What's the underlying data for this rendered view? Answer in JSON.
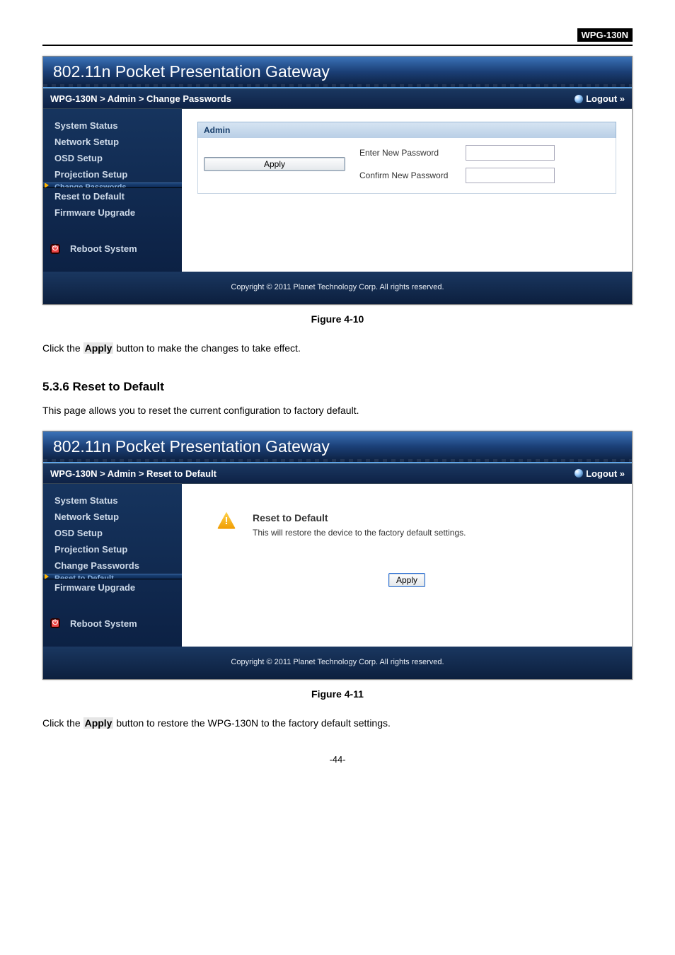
{
  "model_tag": "WPG-130N",
  "router_title": "802.11n Pocket Presentation Gateway",
  "logout_label": "Logout »",
  "copyright": "Copyright © 2011 Planet Technology Corp. All rights reserved.",
  "fig1": {
    "breadcrumb": "WPG-130N > Admin > Change Passwords",
    "sidebar": {
      "items": [
        "System Status",
        "Network Setup",
        "OSD Setup",
        "Projection Setup"
      ],
      "active": "Change Passwords",
      "items_after": [
        "Reset to Default",
        "Firmware Upgrade"
      ],
      "reboot": "Reboot System"
    },
    "panel": {
      "header": "Admin",
      "row1": "Enter New Password",
      "row2": "Confirm New Password",
      "apply": "Apply"
    },
    "caption": "Figure 4-10"
  },
  "doc1": {
    "pre": "Click the ",
    "hl": "Apply",
    "post": " button to make the changes to take effect."
  },
  "section_536": "5.3.6   Reset to Default",
  "section_536_intro": "This page allows you to reset the current configuration to factory default.",
  "fig2": {
    "breadcrumb": "WPG-130N > Admin > Reset to Default",
    "sidebar": {
      "items": [
        "System Status",
        "Network Setup",
        "OSD Setup",
        "Projection Setup",
        "Change Passwords"
      ],
      "active": "Reset to Default",
      "items_after": [
        "Firmware Upgrade"
      ],
      "reboot": "Reboot System"
    },
    "panel": {
      "title": "Reset to Default",
      "msg": "This will restore the device to the factory default settings.",
      "apply": "Apply"
    },
    "caption": "Figure 4-11"
  },
  "doc2": {
    "pre": "Click the ",
    "hl": "Apply",
    "post": " button to restore the WPG-130N to the factory default settings."
  },
  "page_num": "-44-"
}
